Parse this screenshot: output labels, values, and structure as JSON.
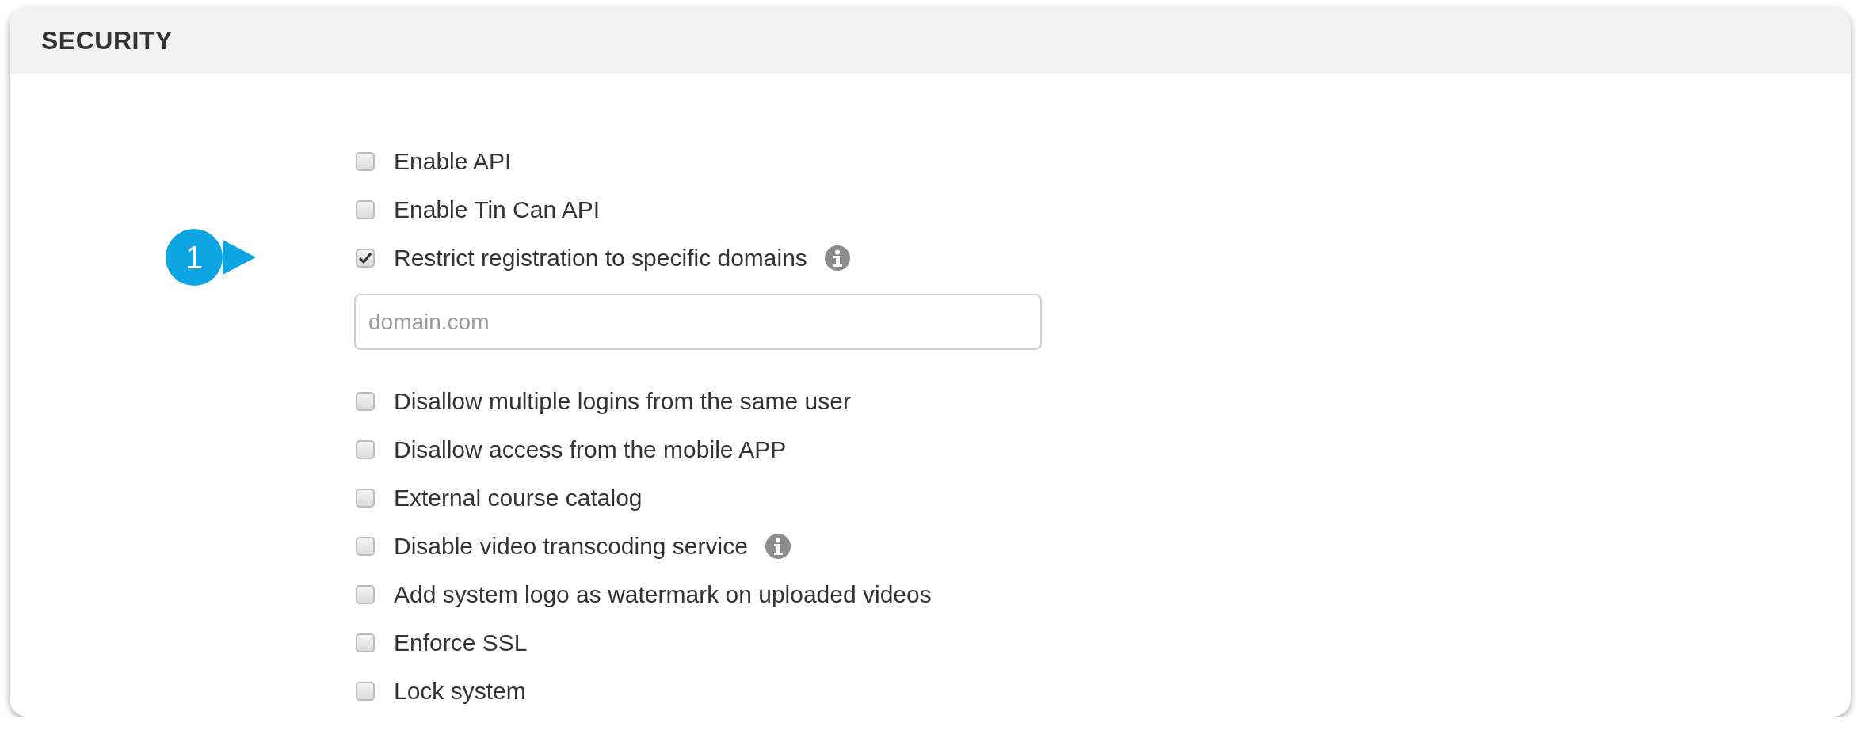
{
  "panel": {
    "title": "SECURITY"
  },
  "options": [
    {
      "kind": "checkbox",
      "label": "Enable API",
      "checked": false,
      "info": false
    },
    {
      "kind": "checkbox",
      "label": "Enable Tin Can API",
      "checked": false,
      "info": false
    },
    {
      "kind": "checkbox",
      "label": "Restrict registration to specific domains",
      "checked": true,
      "info": true,
      "callout": "1"
    },
    {
      "kind": "text_field",
      "placeholder": "domain.com"
    },
    {
      "kind": "checkbox",
      "label": "Disallow multiple logins from the same user",
      "checked": false,
      "info": false
    },
    {
      "kind": "checkbox",
      "label": "Disallow access from the mobile APP",
      "checked": false,
      "info": false
    },
    {
      "kind": "checkbox",
      "label": "External course catalog",
      "checked": false,
      "info": false
    },
    {
      "kind": "checkbox",
      "label": "Disable video transcoding service",
      "checked": false,
      "info": true
    },
    {
      "kind": "checkbox",
      "label": "Add system logo as watermark on uploaded videos",
      "checked": false,
      "info": false
    },
    {
      "kind": "checkbox",
      "label": "Enforce SSL",
      "checked": false,
      "info": false
    },
    {
      "kind": "checkbox",
      "label": "Lock system",
      "checked": false,
      "info": false
    }
  ]
}
